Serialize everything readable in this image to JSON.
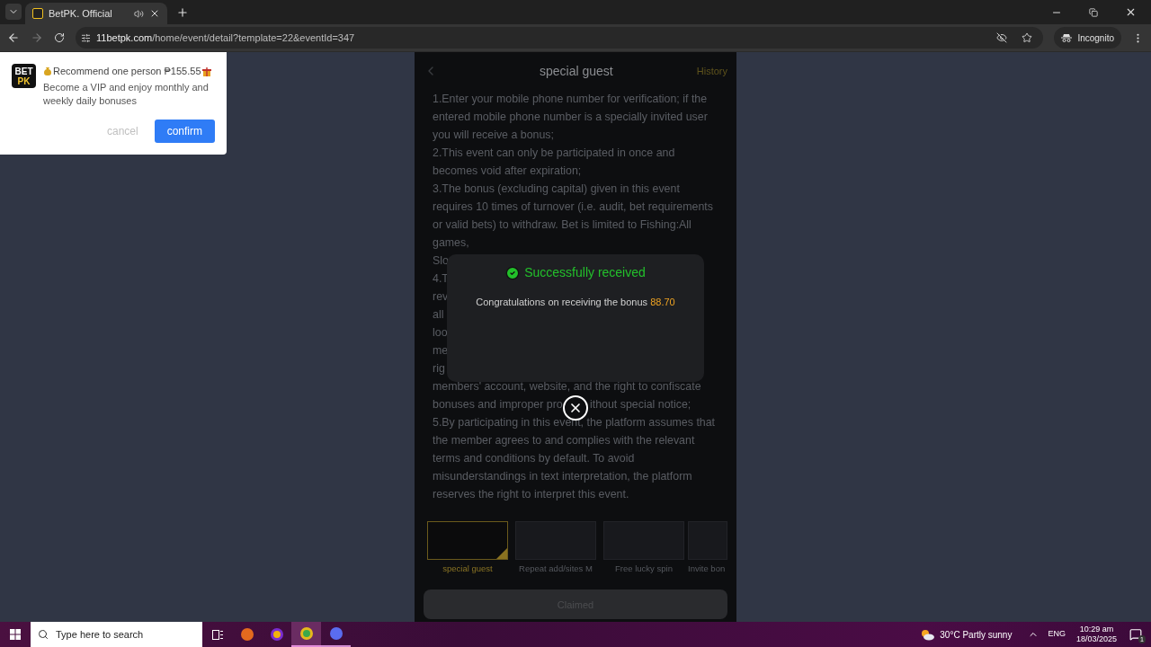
{
  "browser": {
    "tab_title": "BetPK. Official",
    "url_domain": "11betpk.com",
    "url_path": "/home/event/detail?template=22&eventId=347",
    "profile": "Incognito"
  },
  "notification": {
    "logo": [
      "BET",
      "PK"
    ],
    "title": "Recommend one person ₱155.55",
    "body": "Become a VIP and enjoy monthly and weekly daily bonuses",
    "buttons": [
      {
        "label": "cancel",
        "kind": "secondary"
      },
      {
        "label": "confirm",
        "kind": "primary"
      }
    ]
  },
  "page": {
    "title": "special guest",
    "history_link": "History",
    "rules": [
      "1.Enter your mobile phone number for verification; if the",
      "entered mobile phone number is a specially invited user",
      "you will receive a bonus;",
      "2.This event can only be participated in once and",
      "becomes void after expiration;",
      "3.The bonus (excluding capital) given in this event",
      "requires 10 times of turnover (i.e. audit, bet requirements",
      "or valid bets) to withdraw. Bet is limited to Fishing:All",
      "games,",
      "Slo",
      "4.T",
      "rev",
      "all",
      "loo",
      "me",
      "rig",
      "members' account, website, and the right to confiscate",
      [
        "bonuses and improper pro",
        "ithout special notice;"
      ],
      "5.By participating in this event, the platform assumes that",
      "the member agrees to and complies with the relevant",
      "terms and conditions by default. To avoid",
      "misunderstandings in text interpretation, the platform",
      "reserves the right to interpret this event."
    ],
    "events": [
      {
        "label": "special guest",
        "selected": true
      },
      {
        "label": "Repeat add/sites M",
        "selected": false
      },
      {
        "label": "Free lucky spin",
        "selected": false
      },
      {
        "label": "Invite bon",
        "selected": false
      }
    ],
    "claim_button": {
      "label": "Claimed",
      "disabled": true
    }
  },
  "dialog": {
    "title": "Successfully received",
    "message": "Congratulations on receiving the bonus",
    "amount": "88.70"
  },
  "taskbar": {
    "search_placeholder": "Type here to search",
    "weather": {
      "temperature": "30°C",
      "condition": "Partly sunny"
    },
    "language": "ENG",
    "time": "10:29 am",
    "date": "18/03/2025",
    "notification_count": "1"
  }
}
